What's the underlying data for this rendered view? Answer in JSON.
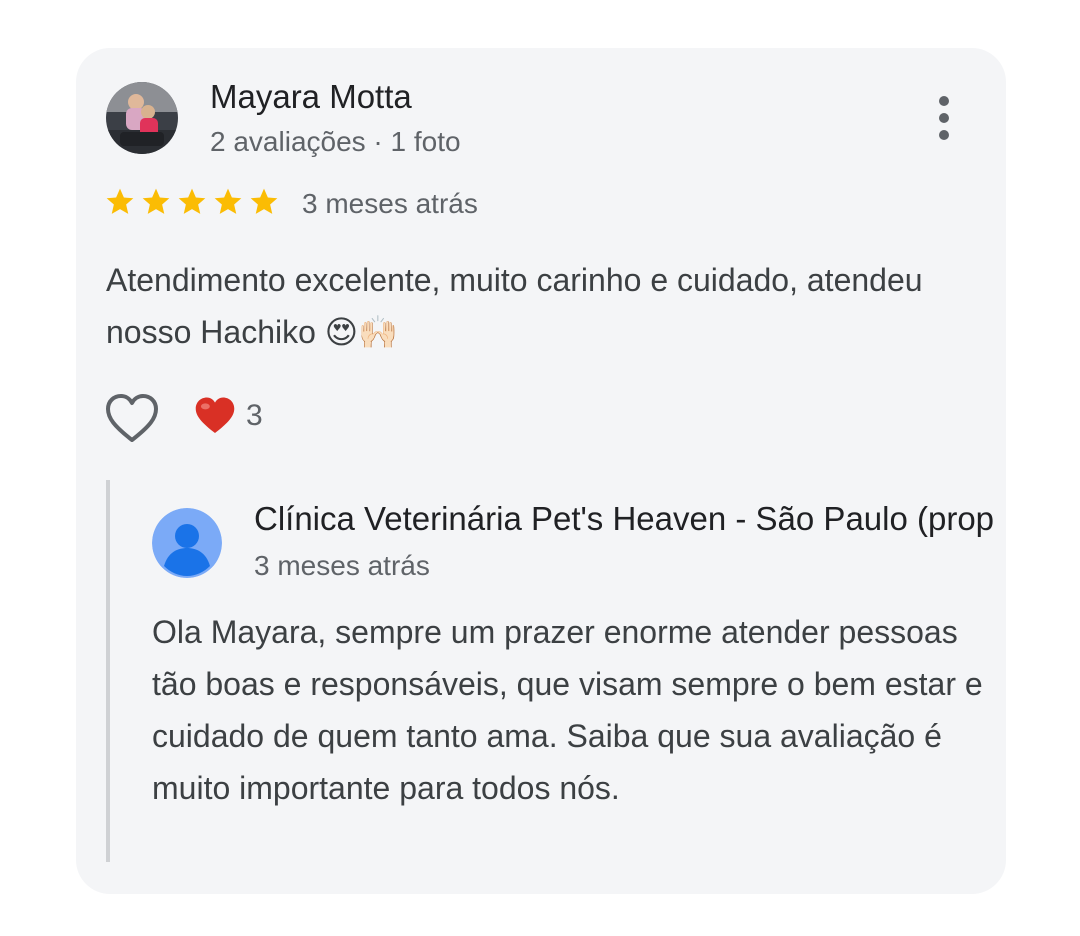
{
  "review": {
    "author_name": "Mayara Motta",
    "author_meta": "2 avaliações · 1 foto",
    "rating": 5,
    "time_ago": "3 meses atrás",
    "text": "Atendimento excelente, muito carinho e cuidado, atendeu nosso Hachiko 😍🙌🏻",
    "reaction_count": "3",
    "icons": [
      "avatar",
      "more-vert-icon",
      "star-icon",
      "heart-outline-icon",
      "red-heart-icon"
    ]
  },
  "reply": {
    "owner_name": "Clínica Veterinária Pet's Heaven - São Paulo (prop",
    "time_ago": "3 meses atrás",
    "text": "Ola Mayara, sempre um prazer enorme atender pessoas tão boas e responsáveis, que visam sempre o bem estar e cuidado de quem tanto ama. Saiba que sua avaliação é muito importante para todos nós.",
    "icons": [
      "person-avatar-icon"
    ]
  },
  "colors": {
    "card_background": "#f4f5f7",
    "star": "#fbbc04",
    "heart": "#d93025",
    "avatar_blue": "#7baaf7",
    "text_primary": "#202124",
    "text_secondary": "#5f6368"
  }
}
